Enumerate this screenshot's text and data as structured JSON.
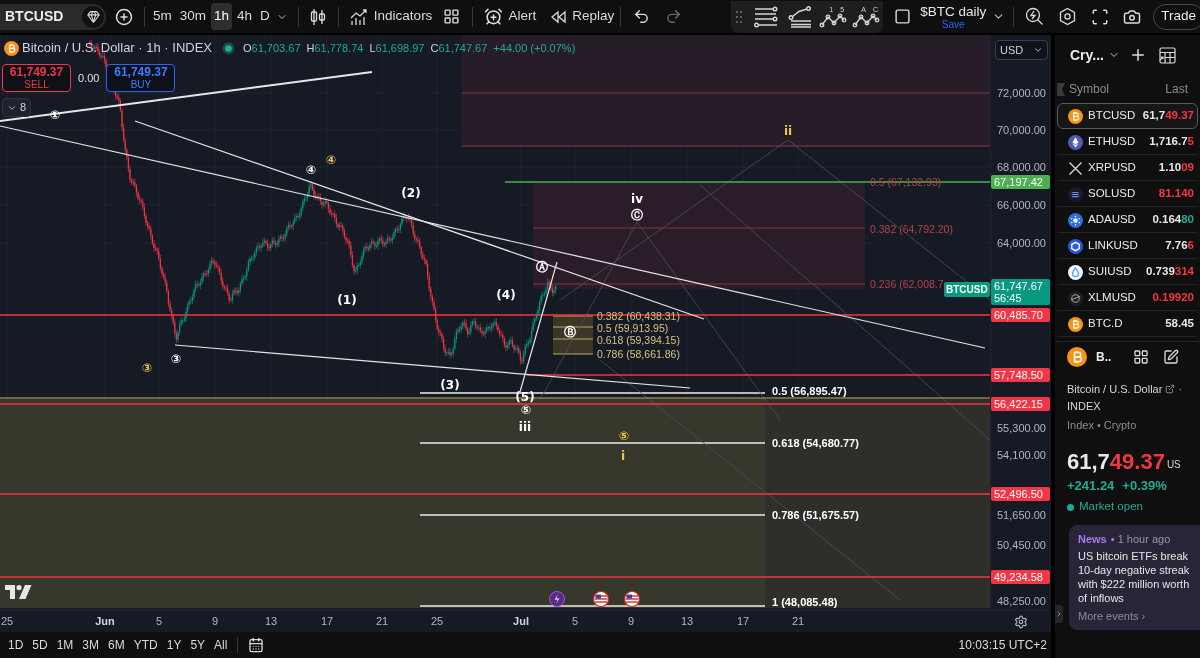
{
  "toolbar": {
    "symbol": "BTCUSD",
    "intervals": [
      {
        "label": "5m",
        "selected": false
      },
      {
        "label": "30m",
        "selected": false
      },
      {
        "label": "1h",
        "selected": true
      },
      {
        "label": "4h",
        "selected": false
      },
      {
        "label": "D",
        "selected": false
      }
    ],
    "indicators": "Indicators",
    "alert": "Alert",
    "replay": "Replay",
    "drawing_tools": [
      {
        "kind": "fib-retracement"
      },
      {
        "kind": "fib-channel"
      },
      {
        "kind": "wave",
        "marks": [
          "1",
          "5"
        ]
      },
      {
        "kind": "wave",
        "marks": [
          "A",
          "C"
        ]
      }
    ],
    "layout": {
      "name": "$BTC daily",
      "status": "Save"
    },
    "trade": "Trade"
  },
  "chart": {
    "legend": {
      "title": "Bitcoin / U.S. Dollar · 1h · INDEX",
      "ohlc": [
        {
          "label": "O",
          "value": "61,703.67"
        },
        {
          "label": "H",
          "value": "61,778.74"
        },
        {
          "label": "L",
          "value": "61,698.97"
        },
        {
          "label": "C",
          "value": "61,747.67"
        }
      ],
      "change": "+44.00 (+0.07%)"
    },
    "sell": {
      "price": "61,749.37",
      "label": "SELL"
    },
    "spread": "0.00",
    "buy": {
      "price": "61,749.37",
      "label": "BUY"
    },
    "indicators_count": "8",
    "wave_labels": [
      {
        "text": "①",
        "color": "#ffffff"
      },
      {
        "text": "ii",
        "color": "#e6c84a"
      },
      {
        "text": "④",
        "color": "#e6c84a"
      },
      {
        "text": "④",
        "color": "#ffffff"
      },
      {
        "text": "(2)",
        "color": "#ffffff"
      },
      {
        "text": "iv",
        "color": "#ffffff"
      },
      {
        "text": "Ⓒ",
        "color": "#ffffff"
      },
      {
        "text": "Ⓐ",
        "color": "#ffffff"
      },
      {
        "text": "(4)",
        "color": "#ffffff"
      },
      {
        "text": "(1)",
        "color": "#ffffff"
      },
      {
        "text": "Ⓑ",
        "color": "#ffffff"
      },
      {
        "text": "③",
        "color": "#ffffff"
      },
      {
        "text": "③",
        "color": "#e6c84a"
      },
      {
        "text": "(3)",
        "color": "#ffffff"
      },
      {
        "text": "(5)",
        "color": "#ffffff"
      },
      {
        "text": "⑤",
        "color": "#ffffff"
      },
      {
        "text": "iii",
        "color": "#ffffff"
      },
      {
        "text": "⑤",
        "color": "#e6c84a"
      },
      {
        "text": "i",
        "color": "#e6c84a"
      }
    ],
    "fib_labels": [
      {
        "text": "0.5 (67,132.93)",
        "color": "#b5424a",
        "kind": "retracement"
      },
      {
        "text": "0.382 (64,792.20)",
        "color": "#b5424a",
        "kind": "retracement"
      },
      {
        "text": "0.236 (62,008.7",
        "color": "#b5424a",
        "kind": "retracement"
      },
      {
        "text": "0.382 (60,438.31)",
        "color": "#d4c27e",
        "kind": "retracement"
      },
      {
        "text": "0.5 (59,913.95)",
        "color": "#d4c27e",
        "kind": "retracement"
      },
      {
        "text": "0.618 (59,394.15)",
        "color": "#d4c27e",
        "kind": "retracement"
      },
      {
        "text": "0.786 (58,661.86)",
        "color": "#d4c27e",
        "kind": "retracement"
      },
      {
        "text": "0.5 (56,895.47)",
        "color": "#ffffff",
        "kind": "extension"
      },
      {
        "text": "0.618 (54,680.77)",
        "color": "#ffffff",
        "kind": "extension"
      },
      {
        "text": "0.786 (51,675.57)",
        "color": "#ffffff",
        "kind": "extension"
      },
      {
        "text": "1 (48,085.48)",
        "color": "#ffffff",
        "kind": "extension"
      }
    ],
    "symbol_tag": "BTCUSD",
    "events": [
      {
        "kind": "lightning"
      },
      {
        "kind": "flag"
      },
      {
        "kind": "flag"
      }
    ]
  },
  "price_axis": {
    "currency": "USD",
    "ticks": [
      "72,000.00",
      "70,000.00",
      "68,000.00",
      "66,000.00",
      "64,000.00",
      "55,300.00",
      "54,100.00",
      "51,650.00",
      "50,450.00",
      "48,250.00"
    ],
    "tags": [
      {
        "price": "67,197.42",
        "color": "#4caf50"
      },
      {
        "price": "61,747.67",
        "countdown": "56:45",
        "color": "#089981"
      },
      {
        "price": "60,485.70",
        "color": "#f23645"
      },
      {
        "price": "57,748.50",
        "color": "#f23645"
      },
      {
        "price": "56,422.15",
        "color": "#f23645"
      },
      {
        "price": "52,496.50",
        "color": "#f23645"
      },
      {
        "price": "49,234.58",
        "color": "#f23645"
      }
    ]
  },
  "time_axis": {
    "ticks": [
      {
        "label": "25",
        "kind": "day"
      },
      {
        "label": "Jun",
        "kind": "month"
      },
      {
        "label": "5",
        "kind": "day"
      },
      {
        "label": "9",
        "kind": "day"
      },
      {
        "label": "13",
        "kind": "day"
      },
      {
        "label": "17",
        "kind": "day"
      },
      {
        "label": "21",
        "kind": "day"
      },
      {
        "label": "25",
        "kind": "day"
      },
      {
        "label": "Jul",
        "kind": "month"
      },
      {
        "label": "5",
        "kind": "day"
      },
      {
        "label": "9",
        "kind": "day"
      },
      {
        "label": "13",
        "kind": "day"
      },
      {
        "label": "17",
        "kind": "day"
      },
      {
        "label": "21",
        "kind": "day"
      }
    ]
  },
  "range_bar": {
    "ranges": [
      "1D",
      "5D",
      "1M",
      "3M",
      "6M",
      "YTD",
      "1Y",
      "5Y",
      "All"
    ],
    "clock": "10:03:15 UTC+2"
  },
  "watchlist": {
    "title": "Cry...",
    "columns": [
      "Symbol",
      "Last"
    ],
    "rows": [
      {
        "symbol": "BTCUSD",
        "last": "61,7",
        "last_tick": "49.37",
        "color": "#f23645",
        "selected": true
      },
      {
        "symbol": "ETHUSD",
        "last": "1,716.7",
        "last_tick": "5",
        "color": "#f23645",
        "selected": false
      },
      {
        "symbol": "XRPUSD",
        "last": "1.10",
        "last_tick": "09",
        "color": "#f23645",
        "selected": false
      },
      {
        "symbol": "SOLUSD",
        "last_tick": "81.140",
        "color": "#f23645",
        "selected": false
      },
      {
        "symbol": "ADAUSD",
        "last": "0.164",
        "last_tick": "80",
        "color": "#22ab94",
        "selected": false
      },
      {
        "symbol": "LINKUSD",
        "last": "7.76",
        "last_tick": "6",
        "color": "#f23645",
        "selected": false
      },
      {
        "symbol": "SUIUSD",
        "last": "0.739",
        "last_tick": "314",
        "color": "#f23645",
        "selected": false
      },
      {
        "symbol": "XLMUSD",
        "last_tick": "0.19920",
        "color": "#f23645",
        "selected": false
      },
      {
        "symbol": "BTC.D",
        "last": "58.45",
        "selected": false
      }
    ]
  },
  "details": {
    "symbol": "B..",
    "name": "Bitcoin / U.S. Dollar",
    "separator": "·",
    "exchange": "INDEX",
    "category": "Index • Crypto",
    "price": {
      "main": "61,7",
      "tick": "49.37",
      "color": "#f23645"
    },
    "currency": "US",
    "change": "+241.24",
    "change_percent": "+0.39%",
    "status": "Market open",
    "news": {
      "source": "News",
      "time": "• 1 hour ago",
      "headline": "US bitcoin ETFs break 10-day negative streak with $222 million worth of inflows",
      "more": "More events ›"
    }
  }
}
